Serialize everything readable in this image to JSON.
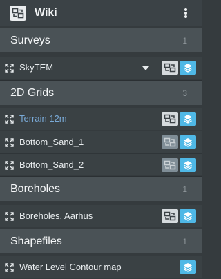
{
  "header": {
    "title": "Wiki",
    "logo_icon": "grid-swap-icon",
    "menu_icon": "more-vertical-icon"
  },
  "sections": [
    {
      "label": "Surveys",
      "count": "1",
      "rows": [
        {
          "name": "SkyTEM",
          "style": "normal",
          "has_dropdown": true,
          "grid_button": "light",
          "layer_button": true
        }
      ]
    },
    {
      "label": "2D Grids",
      "count": "3",
      "rows": [
        {
          "name": "Terrain 12m",
          "style": "link",
          "has_dropdown": false,
          "grid_button": "light",
          "layer_button": true
        },
        {
          "name": "Bottom_Sand_1",
          "style": "normal",
          "has_dropdown": false,
          "grid_button": "dim",
          "layer_button": true
        },
        {
          "name": "Bottom_Sand_2",
          "style": "normal",
          "has_dropdown": false,
          "grid_button": "dim",
          "layer_button": true
        }
      ]
    },
    {
      "label": "Boreholes",
      "count": "1",
      "rows": [
        {
          "name": "Boreholes, Aarhus",
          "style": "normal",
          "has_dropdown": false,
          "grid_button": "light",
          "layer_button": true
        }
      ]
    },
    {
      "label": "Shapefiles",
      "count": "1",
      "rows": [
        {
          "name": "Water Level Contour map",
          "style": "normal",
          "has_dropdown": false,
          "grid_button": "none",
          "layer_button": true
        }
      ]
    }
  ],
  "colors": {
    "background": "#353b3e",
    "section_header": "#4a5256",
    "row": "#3a4144",
    "accent_layer": "#4fb8e6",
    "link": "#79a9d6"
  }
}
